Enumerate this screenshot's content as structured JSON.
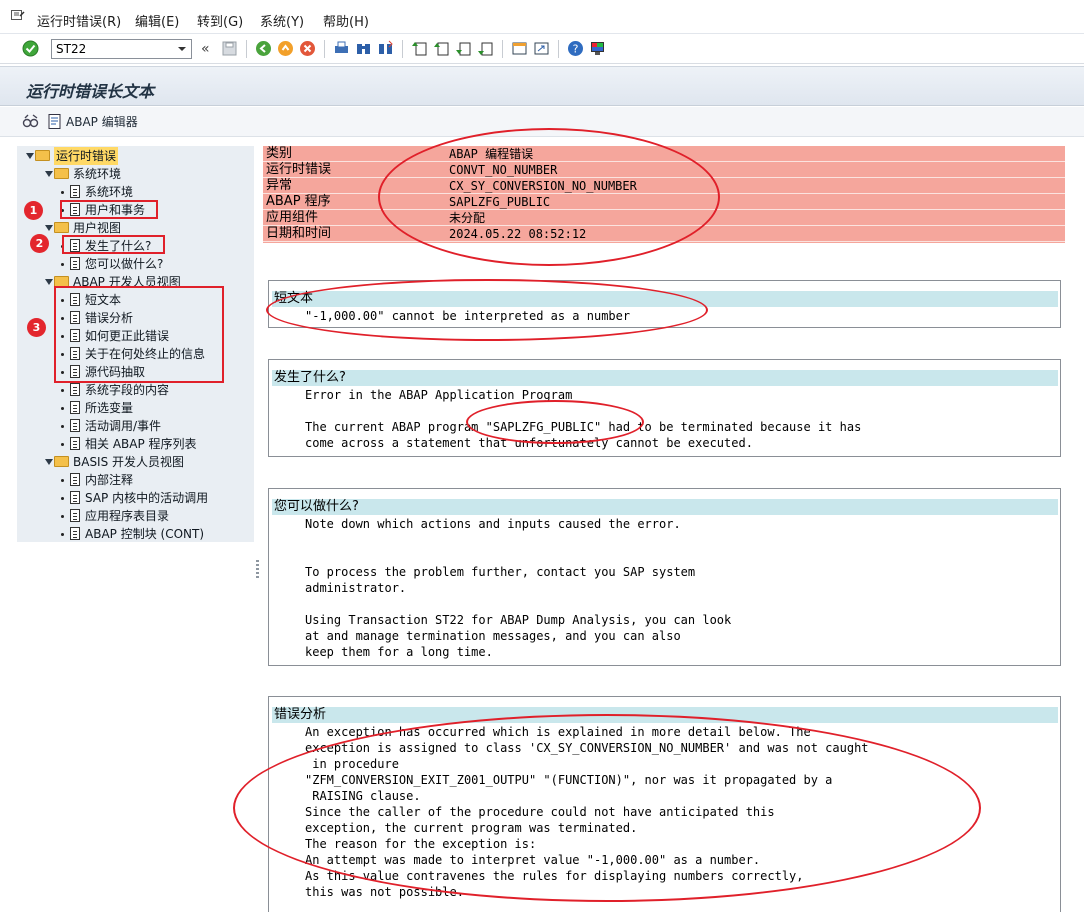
{
  "menu": [
    "运行时错误(R)",
    "编辑(E)",
    "转到(G)",
    "系统(Y)",
    "帮助(H)"
  ],
  "toolbar": {
    "command_value": "ST22",
    "back_chevron": "«"
  },
  "page_title": "运行时错误长文本",
  "app_toolbar": {
    "abap_editor": "ABAP 编辑器"
  },
  "tree": {
    "root": "运行时错误",
    "system_env": "系统环境",
    "system_env_leaf": "系统环境",
    "user_tx": "用户和事务",
    "user_view": "用户视图",
    "what_happened": "发生了什么?",
    "what_can_do": "您可以做什么?",
    "abap_dev_view": "ABAP 开发人员视图",
    "short_text": "短文本",
    "error_analysis": "错误分析",
    "how_correct": "如何更正此错误",
    "termination_info": "关于在何处终止的信息",
    "source_extract": "源代码抽取",
    "system_fields": "系统字段的内容",
    "chosen_vars": "所选变量",
    "active_calls": "活动调用/事件",
    "abap_prog_list": "相关 ABAP 程序列表",
    "basis_dev_view": "BASIS 开发人员视图",
    "internal_notes": "内部注释",
    "sap_kernel_calls": "SAP 内核中的活动调用",
    "app_table_dir": "应用程序表目录",
    "abap_control_blocks": "ABAP 控制块 (CONT)"
  },
  "badges": [
    "1",
    "2",
    "3"
  ],
  "header_rows": [
    {
      "key": "类别",
      "value": "ABAP 编程错误"
    },
    {
      "key": "运行时错误",
      "value": "CONVT_NO_NUMBER"
    },
    {
      "key": "异常",
      "value": "CX_SY_CONVERSION_NO_NUMBER"
    },
    {
      "key": "ABAP 程序",
      "value": "SAPLZFG_PUBLIC"
    },
    {
      "key": "应用组件",
      "value": "未分配"
    },
    {
      "key": "日期和时间",
      "value": "2024.05.22 08:52:12"
    }
  ],
  "sections": {
    "short_text": {
      "title": "短文本",
      "lines": [
        "\"-1,000.00\" cannot be interpreted as a number"
      ]
    },
    "what_happened": {
      "title": "发生了什么?",
      "lines": [
        "Error in the ABAP Application Program",
        "",
        "The current ABAP program \"SAPLZFG_PUBLIC\" had to be terminated because it has",
        "come across a statement that unfortunately cannot be executed."
      ]
    },
    "what_can_do": {
      "title": "您可以做什么?",
      "lines": [
        "Note down which actions and inputs caused the error.",
        "",
        "",
        "To process the problem further, contact you SAP system",
        "administrator.",
        "",
        "Using Transaction ST22 for ABAP Dump Analysis, you can look",
        "at and manage termination messages, and you can also",
        "keep them for a long time."
      ]
    },
    "error_analysis": {
      "title": "错误分析",
      "lines": [
        "An exception has occurred which is explained in more detail below. The",
        "exception is assigned to class 'CX_SY_CONVERSION_NO_NUMBER' and was not caught",
        " in procedure",
        "\"ZFM_CONVERSION_EXIT_Z001_OUTPU\" \"(FUNCTION)\", nor was it propagated by a",
        " RAISING clause.",
        "Since the caller of the procedure could not have anticipated this",
        "exception, the current program was terminated.",
        "The reason for the exception is:",
        "An attempt was made to interpret value \"-1,000.00\" as a number.",
        "As this value contravenes the rules for displaying numbers correctly,",
        "this was not possible."
      ]
    }
  }
}
